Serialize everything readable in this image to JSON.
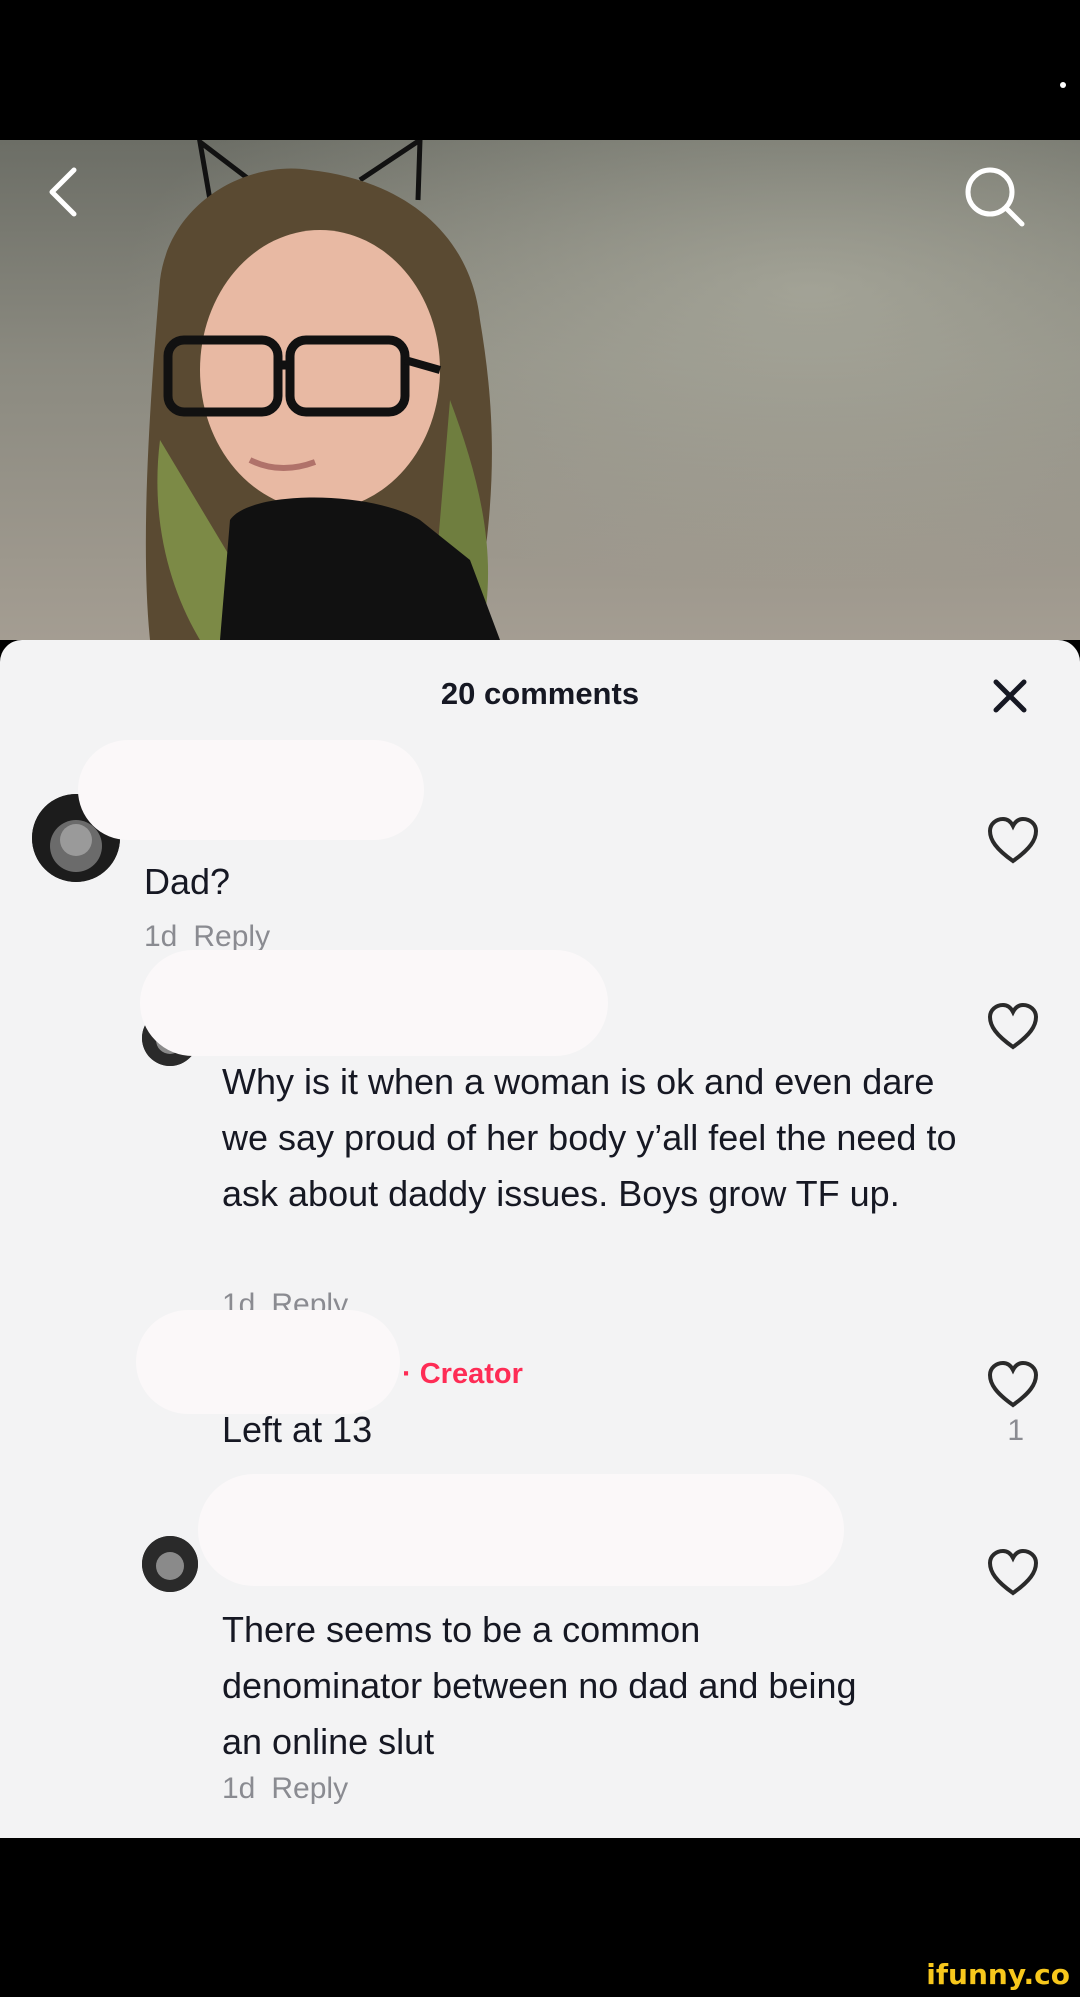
{
  "header": {
    "back_icon": "chevron-left-icon",
    "search_icon": "search-icon"
  },
  "comments_panel": {
    "title": "20 comments",
    "close_icon": "close-icon"
  },
  "comments": [
    {
      "text": "Dad?",
      "time": "1d",
      "reply_label": "Reply"
    },
    {
      "text": "Why is it when a woman is ok and even dare we say proud of her body y’all feel the need to ask about daddy issues. Boys grow TF up.",
      "time": "1d",
      "reply_label": "Reply"
    },
    {
      "badge": "· Creator",
      "text": "Left at 13",
      "likes": "1"
    },
    {
      "text": "There seems to be a common denominator between no dad and being an online slut",
      "time": "1d",
      "reply_label": "Reply"
    }
  ],
  "watermark": "ifunny.co",
  "colors": {
    "accent": "#fe2c55",
    "sheet": "#f3f3f4",
    "watermark": "#f7c71c"
  }
}
